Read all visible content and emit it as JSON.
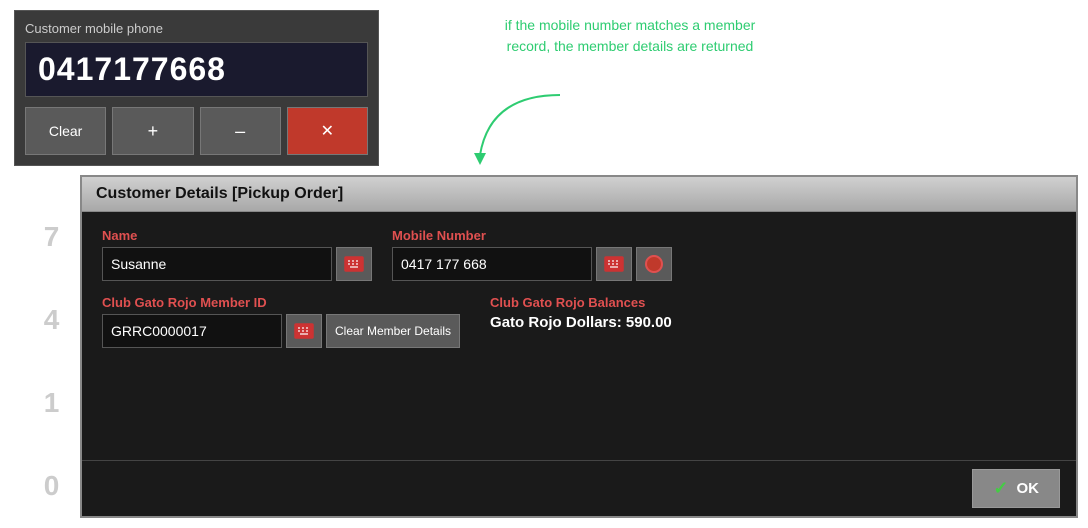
{
  "numpad": {
    "label": "Customer mobile phone",
    "display_value": "0417177668",
    "clear_label": "Clear",
    "plus_label": "+",
    "minus_label": "–",
    "delete_label": "✕"
  },
  "annotation": {
    "text": "if the mobile number matches a member record, the member details are returned"
  },
  "side_numbers": [
    "7",
    "4",
    "1",
    "0"
  ],
  "dialog": {
    "title": "Customer Details  [Pickup Order]",
    "name_label": "Name",
    "name_value": "Susanne",
    "mobile_label": "Mobile Number",
    "mobile_value": "0417 177 668",
    "member_id_label": "Club Gato Rojo Member ID",
    "member_id_value": "GRRC0000017",
    "clear_member_btn": "Clear Member Details",
    "balance_title": "Club Gato Rojo Balances",
    "balance_value": "Gato Rojo Dollars: 590.00",
    "ok_label": "OK"
  }
}
